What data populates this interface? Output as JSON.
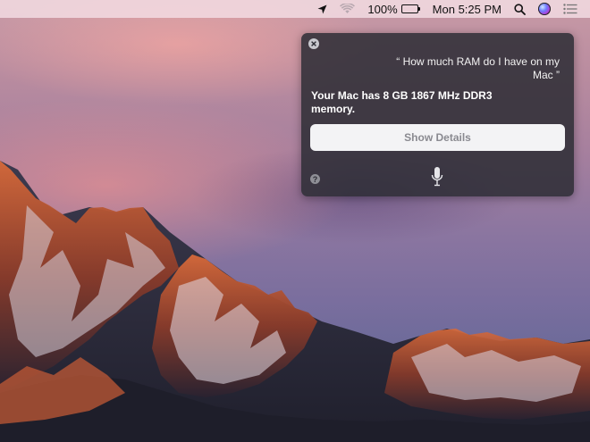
{
  "menubar": {
    "battery_percent": "100%",
    "battery_level": 1.0,
    "clock": "Mon 5:25 PM",
    "icons": [
      "location-arrow-icon",
      "wifi-icon",
      "battery-charging-icon",
      "spotlight-search-icon",
      "siri-icon",
      "notification-center-icon"
    ]
  },
  "siri": {
    "query": "“ How much RAM do I have on my Mac ”",
    "answer": "Your Mac has 8 GB 1867 MHz DDR3 memory.",
    "details_button_label": "Show Details",
    "close_icon": "close-icon",
    "help_icon": "help-icon",
    "help_glyph": "?",
    "mic_icon": "microphone-icon"
  },
  "colors": {
    "panel": "#2c2c34",
    "button_bg": "#f3f3f5",
    "button_text": "#8a8a90"
  }
}
